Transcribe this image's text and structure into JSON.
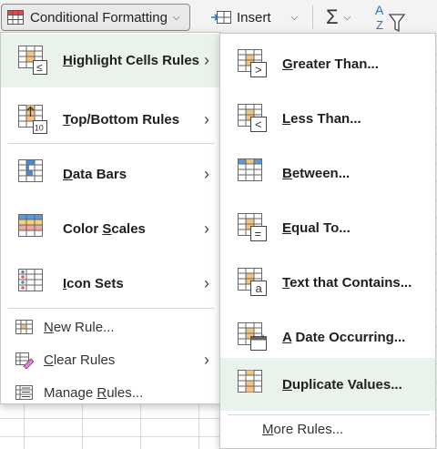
{
  "ribbon": {
    "conditional_formatting": "Conditional Formatting",
    "insert": "Insert",
    "sum_symbol": "Σ",
    "sort_letters": "A Z"
  },
  "main_menu": {
    "items": [
      {
        "label_u": "H",
        "label_rest": "ighlight Cells Rules",
        "icon": "highlight-cells-rules-icon",
        "has_submenu": true,
        "active": true
      },
      {
        "label_u": "T",
        "label_rest": "op/Bottom Rules",
        "icon": "top-bottom-rules-icon",
        "has_submenu": true,
        "badge": "10"
      },
      {
        "label_u": "D",
        "label_rest": "ata Bars",
        "icon": "data-bars-icon",
        "has_submenu": true
      },
      {
        "label_u": "",
        "label_pre": "Color ",
        "label_mid_u": "S",
        "label_rest": "cales",
        "icon": "color-scales-icon",
        "has_submenu": true
      },
      {
        "label_u": "I",
        "label_rest": "con Sets",
        "icon": "icon-sets-icon",
        "has_submenu": true
      }
    ],
    "small_items": [
      {
        "label_u": "N",
        "label_rest": "ew Rule...",
        "icon": "new-rule-icon"
      },
      {
        "label_u": "C",
        "label_rest": "lear Rules",
        "icon": "clear-rules-icon",
        "has_submenu": true
      },
      {
        "label_pre": "Manage ",
        "label_u": "R",
        "label_rest": "ules...",
        "icon": "manage-rules-icon"
      }
    ]
  },
  "sub_menu": {
    "items": [
      {
        "label_u": "G",
        "label_rest": "reater Than...",
        "glyph": ">",
        "icon": "greater-than-icon"
      },
      {
        "label_u": "L",
        "label_rest": "ess Than...",
        "glyph": "<",
        "icon": "less-than-icon"
      },
      {
        "label_u": "B",
        "label_rest": "etween...",
        "icon": "between-icon"
      },
      {
        "label_u": "E",
        "label_rest": "qual To...",
        "glyph": "=",
        "icon": "equal-to-icon"
      },
      {
        "label_u": "T",
        "label_rest": "ext that Contains...",
        "glyph": "a",
        "icon": "text-contains-icon"
      },
      {
        "label_u": "A",
        "label_rest": " Date Occurring...",
        "icon": "date-occurring-icon"
      },
      {
        "label_u": "D",
        "label_rest": "uplicate Values...",
        "icon": "duplicate-values-icon",
        "active": true
      }
    ],
    "more_rules_u": "M",
    "more_rules_rest": "ore Rules..."
  },
  "colors": {
    "active_bg": "#eaf2ec",
    "orange": "#f7c27a",
    "blue": "#5b9bd5",
    "red": "#f4a6a6",
    "cf_red": "#c0392b"
  }
}
